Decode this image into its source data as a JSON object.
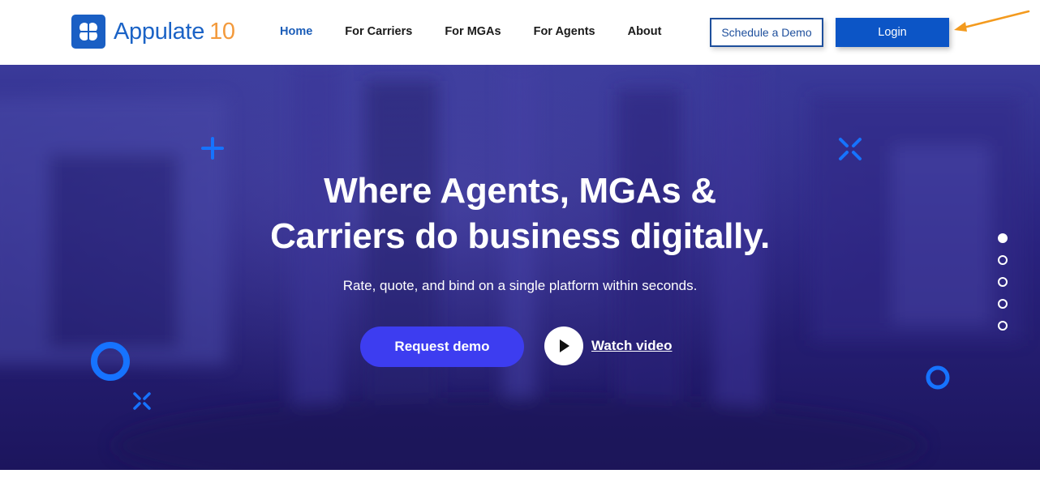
{
  "header": {
    "logo": {
      "name": "Appulate",
      "version": "10",
      "icon": "clover-logo-icon"
    },
    "nav": [
      {
        "label": "Home",
        "active": true
      },
      {
        "label": "For Carriers",
        "active": false
      },
      {
        "label": "For MGAs",
        "active": false
      },
      {
        "label": "For Agents",
        "active": false
      },
      {
        "label": "About",
        "active": false
      }
    ],
    "schedule_demo_label": "Schedule a Demo",
    "login_label": "Login"
  },
  "hero": {
    "title_line1": "Where Agents, MGAs &",
    "title_line2": "Carriers do business digitally.",
    "subtitle": "Rate, quote, and bind on a single platform within seconds.",
    "request_demo_label": "Request demo",
    "watch_video_label": "Watch video",
    "play_icon": "play-icon",
    "slider": {
      "total": 5,
      "active_index": 0
    }
  },
  "colors": {
    "brand_blue": "#1b63c6",
    "version_orange": "#f39a3c",
    "login_blue": "#0c55c6",
    "request_button": "#3d3df0",
    "hero_overlay": "#2a237e",
    "accent_blue": "#1673ff",
    "annotation_arrow": "#f39a1e"
  }
}
